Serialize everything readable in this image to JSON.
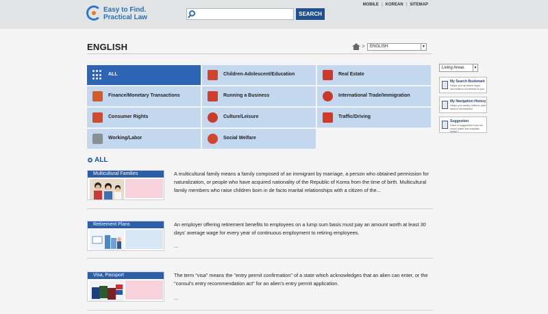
{
  "header": {
    "logo_line1": "Easy to Find.",
    "logo_line2": "Practical Law",
    "search_placeholder": "",
    "search_button": "SEARCH",
    "links": [
      "MOBILE",
      "KOREAN",
      "SITEMAP"
    ]
  },
  "page": {
    "title": "ENGLISH",
    "breadcrumb_sep": ">",
    "language": "ENGLISH",
    "dropdown_arrow": "▼"
  },
  "categories": [
    {
      "label": "ALL",
      "icon": "all-grid-icon",
      "color": "#ffffff"
    },
    {
      "label": "Children-Adolescent/Education",
      "icon": "family-icon",
      "color": "#d0442d"
    },
    {
      "label": "Real Estate",
      "icon": "building-icon",
      "color": "#cc3a2a"
    },
    {
      "label": "Finance/Monetary Transactions",
      "icon": "money-icon",
      "color": "#d4592d"
    },
    {
      "label": "Running a Business",
      "icon": "people-icon",
      "color": "#cf3f2e"
    },
    {
      "label": "International Trade/Immigration",
      "icon": "globe-icon",
      "color": "#c9392a"
    },
    {
      "label": "Consumer Rights",
      "icon": "cart-icon",
      "color": "#d04a2f"
    },
    {
      "label": "Culture/Leisure",
      "icon": "culture-icon",
      "color": "#c83b29"
    },
    {
      "label": "Traffic/Driving",
      "icon": "car-icon",
      "color": "#d23a27"
    },
    {
      "label": "Working/Labor",
      "icon": "tools-icon",
      "color": "#8a8f96"
    },
    {
      "label": "Social Welfare",
      "icon": "welfare-icon",
      "color": "#d2452c"
    }
  ],
  "sidebar": {
    "select_value": "Living Areas",
    "boxes": [
      {
        "title": "My Search Bookmark",
        "desc": "Helps you archieve legal information of interest to you"
      },
      {
        "title": "My Navigation History",
        "desc": "Helps you easily retrieve past search information"
      },
      {
        "title": "Suggestion",
        "desc": "Have a suggestion how we could make the easylaw better?"
      }
    ]
  },
  "section": {
    "title": "ALL"
  },
  "items": [
    {
      "tag": "Multicultural Families",
      "desc": "A multicultural family means a family composed of an immigrant by marriage, a person who obtained permission for naturalization, or people who have acquired nationality of the Republic of Korea from the time of birth. Multicultural family members who raise children born in de facto marital relationships with a citizen of the...",
      "more": ""
    },
    {
      "tag": "Retirement Plans",
      "desc": "An employer offering retirement benefits to employees on a lump sum basis must pay an amount worth at least 30 days' average wage for every year of continuous employment to retiring employees.",
      "more": "..."
    },
    {
      "tag": "Visa, Passport",
      "desc": "The term \"visa\" means the \"entry permit confirmation\" of a state which acknowledges that an alien can enter, or the \"consul's entry recommendation act\" for an alien's entry permit application.",
      "more": "..."
    }
  ]
}
